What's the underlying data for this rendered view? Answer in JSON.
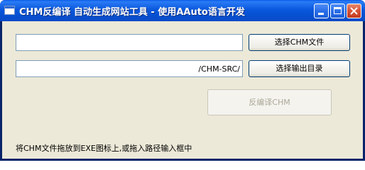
{
  "window": {
    "title": "CHM反编译 自动生成网站工具 - 使用AAuto语言开发",
    "icon": "app-window-icon"
  },
  "titlebar_buttons": {
    "minimize": "minimize-icon",
    "maximize": "maximize-icon",
    "close": "close-icon"
  },
  "form": {
    "chm_file_value": "",
    "output_dir_value": "/CHM-SRC/",
    "select_chm_label": "选择CHM文件",
    "select_output_label": "选择输出目录",
    "decompile_label": "反编译CHM",
    "decompile_enabled": false
  },
  "hint": {
    "text": "将CHM文件拖放到EXE图标上,或拖入路径输入框中"
  },
  "colors": {
    "titlebar": "#0a58dd",
    "client_bg": "#ece9d8",
    "close_button": "#c23b1f",
    "disabled_text": "#aca899"
  }
}
